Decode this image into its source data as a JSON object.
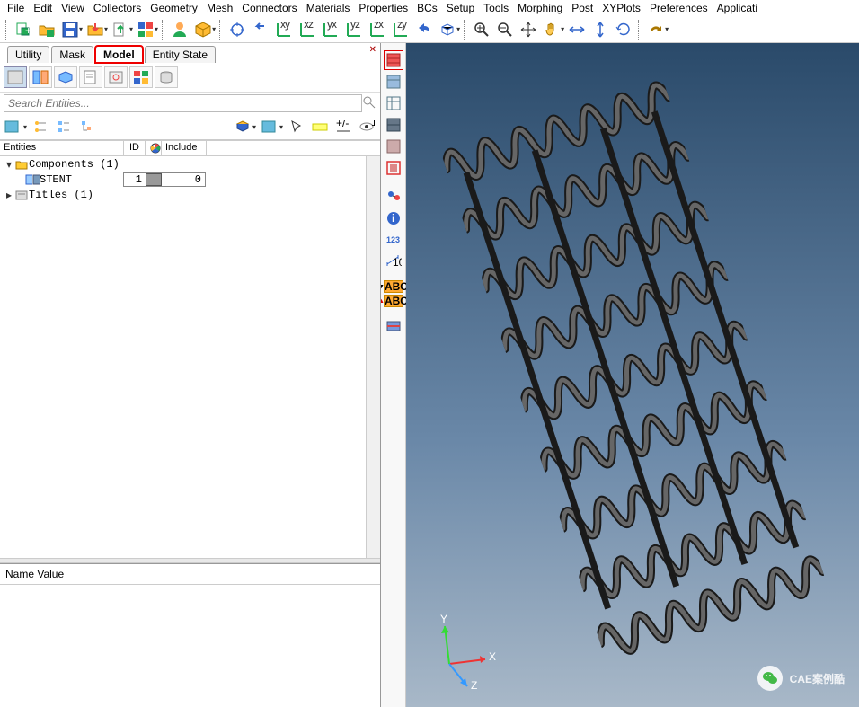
{
  "menu": [
    "File",
    "Edit",
    "View",
    "Collectors",
    "Geometry",
    "Mesh",
    "Connectors",
    "Materials",
    "Properties",
    "BCs",
    "Setup",
    "Tools",
    "Morphing",
    "Post",
    "XYPlots",
    "Preferences",
    "Applications"
  ],
  "tabs": {
    "items": [
      "Utility",
      "Mask",
      "Model",
      "Entity State"
    ],
    "active": "Model"
  },
  "search": {
    "placeholder": "Search Entities..."
  },
  "tree": {
    "cols": {
      "entities": "Entities",
      "id": "ID",
      "include": "Include"
    },
    "rows": [
      {
        "indent": 0,
        "expand": "▾",
        "icon": "folder-comp",
        "label": "Components (1)"
      },
      {
        "indent": 1,
        "expand": "",
        "icon": "entity",
        "label": "STENT",
        "id": "1",
        "color": "#999",
        "include": "0",
        "selected": true
      },
      {
        "indent": 0,
        "expand": "▸",
        "icon": "folder-title",
        "label": "Titles (1)"
      }
    ]
  },
  "prop": {
    "header": "Name Value"
  },
  "triad": {
    "x": "X",
    "y": "Y",
    "z": "Z"
  },
  "watermark": "CAE案例酷",
  "vtool_123": "123",
  "vtool_abc": "ABC"
}
